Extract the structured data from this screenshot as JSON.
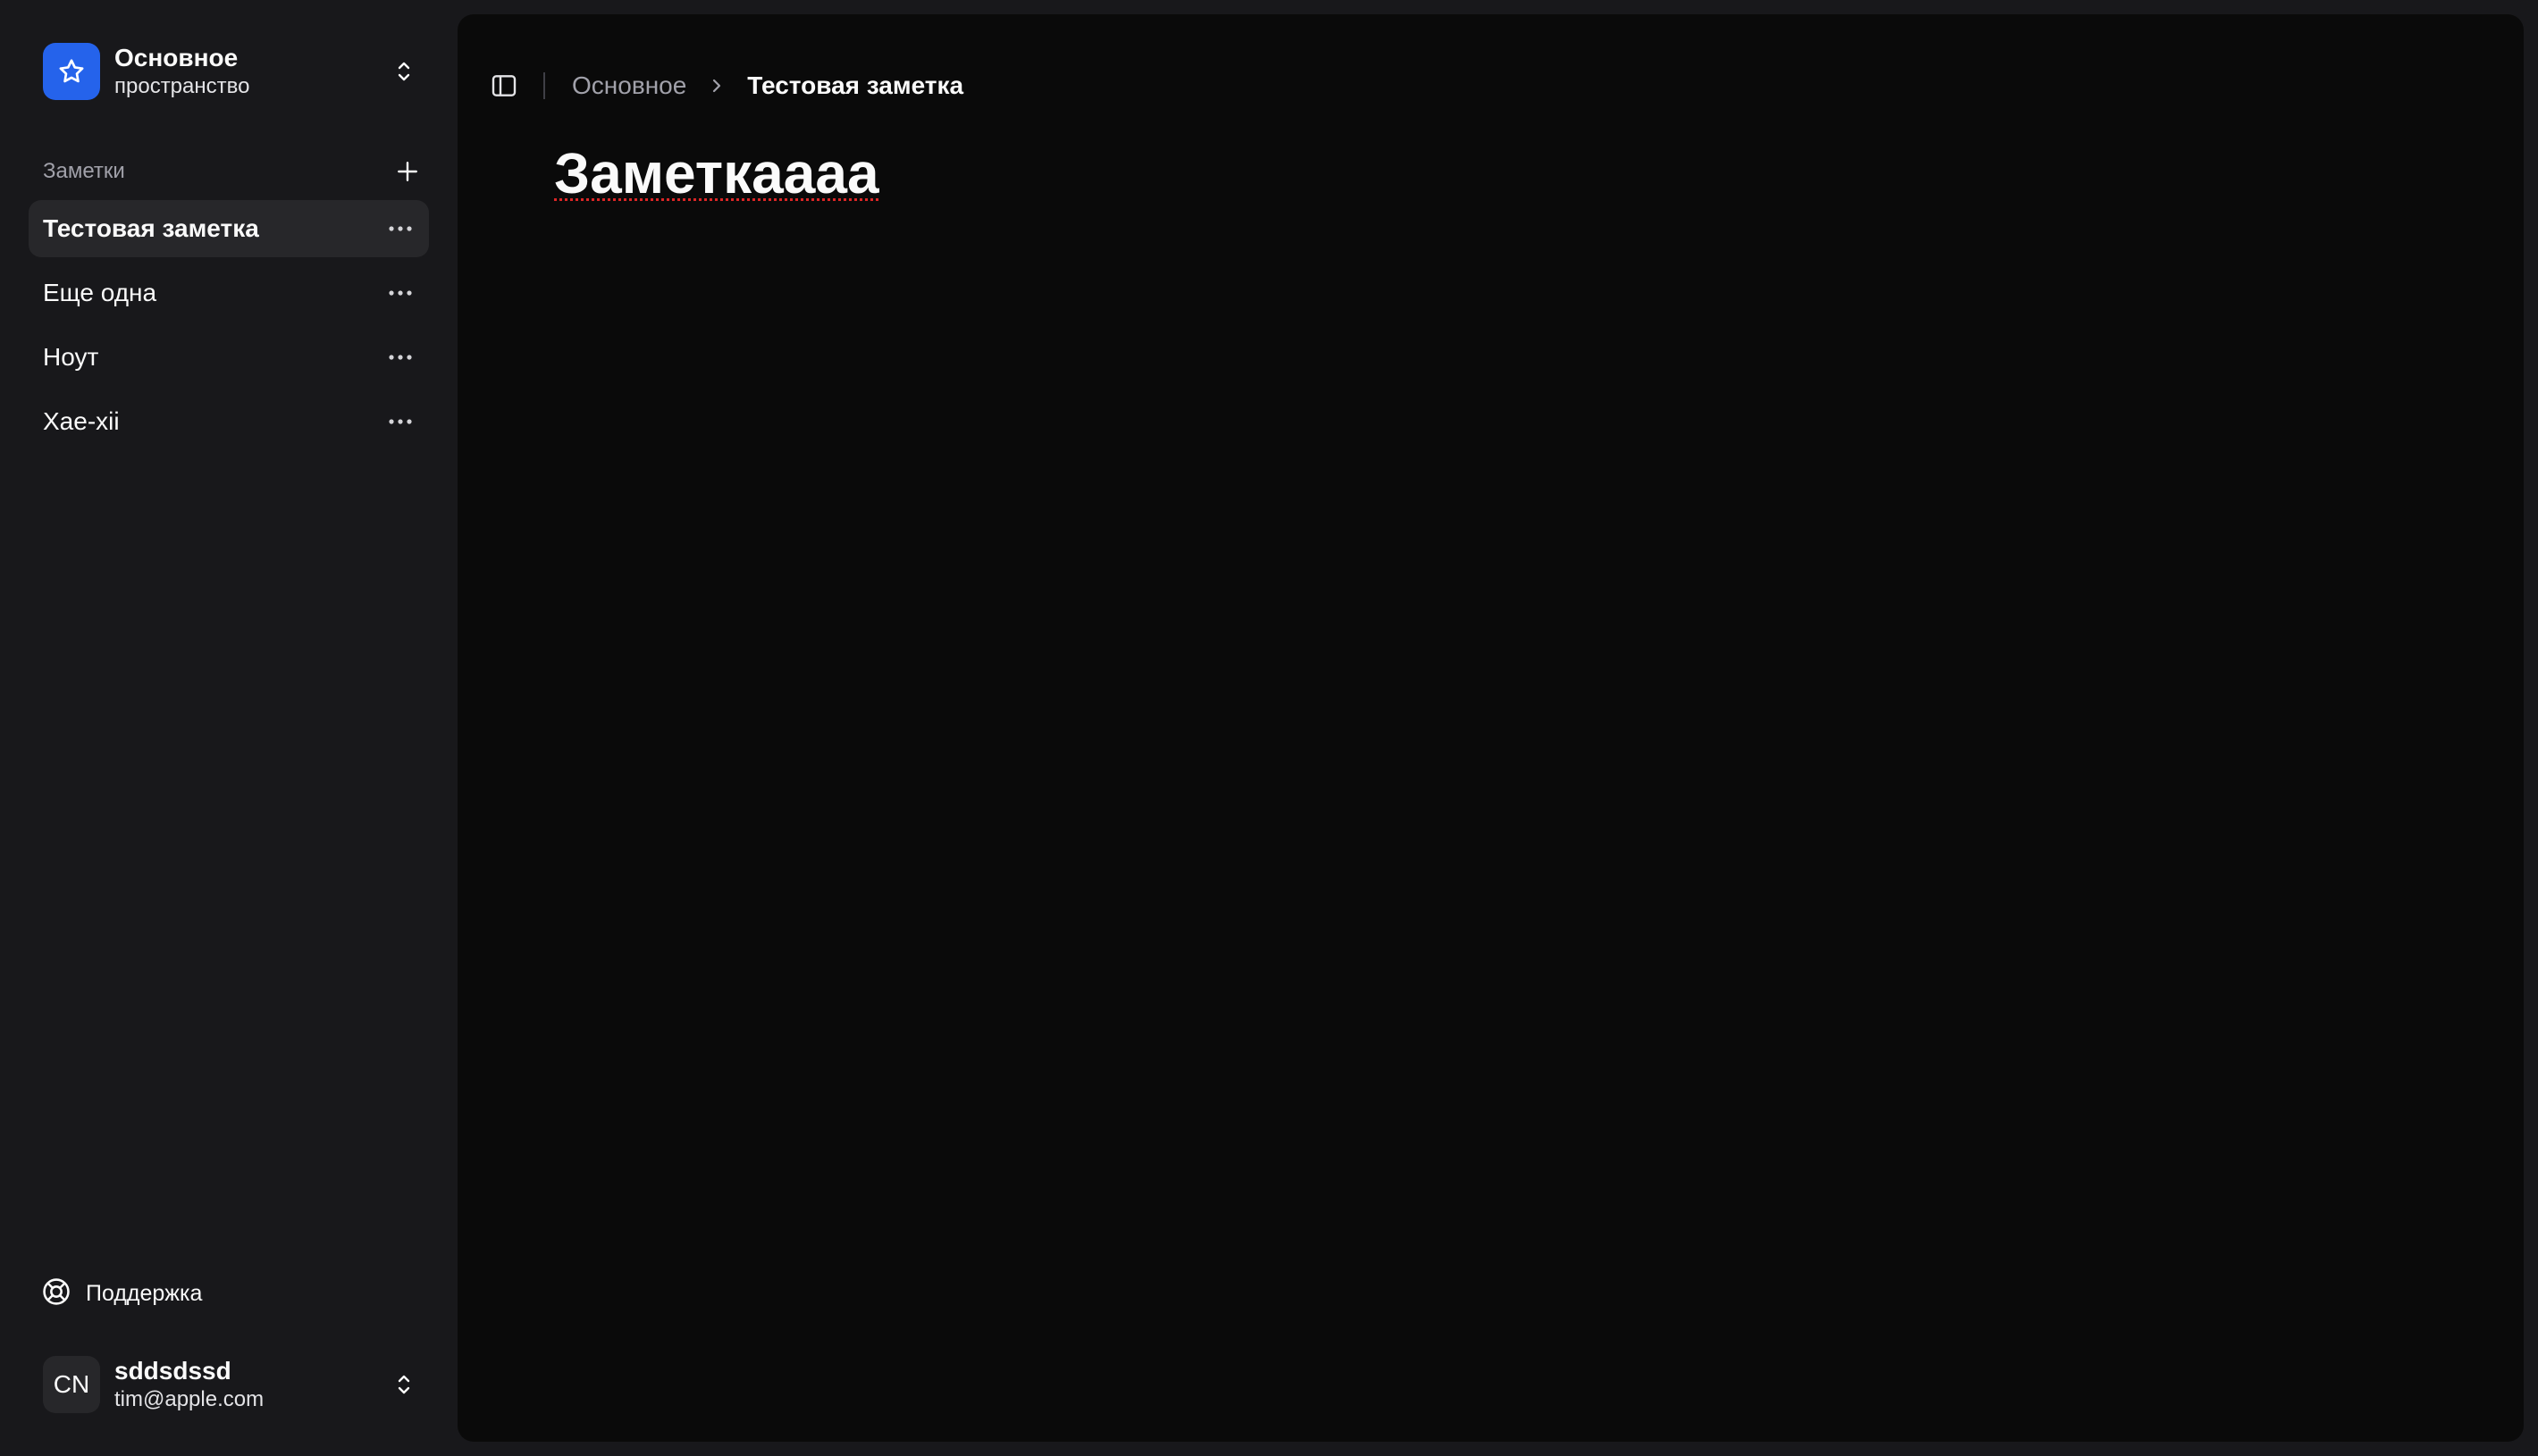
{
  "workspace": {
    "name": "Основное",
    "subtitle": "пространство",
    "logo_icon": "star-icon",
    "accent_color": "#2563eb"
  },
  "notes": {
    "header": "Заметки",
    "items": [
      {
        "label": "Тестовая заметка",
        "active": true
      },
      {
        "label": "Еще одна",
        "active": false
      },
      {
        "label": "Ноут",
        "active": false
      },
      {
        "label": "Хае-хіі",
        "active": false
      }
    ]
  },
  "support": {
    "label": "Поддержка",
    "icon": "lifebuoy-icon"
  },
  "user": {
    "initials": "CN",
    "name": "sddsdssd",
    "email": "tim@apple.com"
  },
  "breadcrumb": {
    "root": "Основное",
    "current": "Тестовая заметка"
  },
  "document": {
    "title": "Заметкаааа"
  }
}
